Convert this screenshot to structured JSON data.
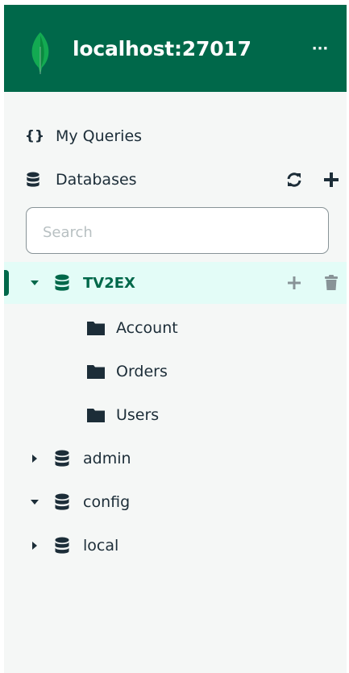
{
  "header": {
    "host": "localhost:27017",
    "more_label": "···"
  },
  "nav": {
    "my_queries": "My Queries",
    "databases": "Databases"
  },
  "search": {
    "placeholder": "Search",
    "value": ""
  },
  "databases": [
    {
      "name": "TV2EX",
      "expanded": true,
      "active": true,
      "collections": [
        "Account",
        "Orders",
        "Users"
      ]
    },
    {
      "name": "admin",
      "expanded": false
    },
    {
      "name": "config",
      "expanded": true
    },
    {
      "name": "local",
      "expanded": false
    }
  ],
  "colors": {
    "brand_green": "#00684a",
    "active_bg": "#e3fcf7",
    "text": "#1c2d38",
    "muted_icon": "#889397"
  },
  "icons": [
    "leaf-logo-icon",
    "ellipsis-icon",
    "braces-icon",
    "database-icon",
    "refresh-icon",
    "plus-icon",
    "trash-icon",
    "caret-down-icon",
    "caret-right-icon",
    "folder-icon"
  ]
}
